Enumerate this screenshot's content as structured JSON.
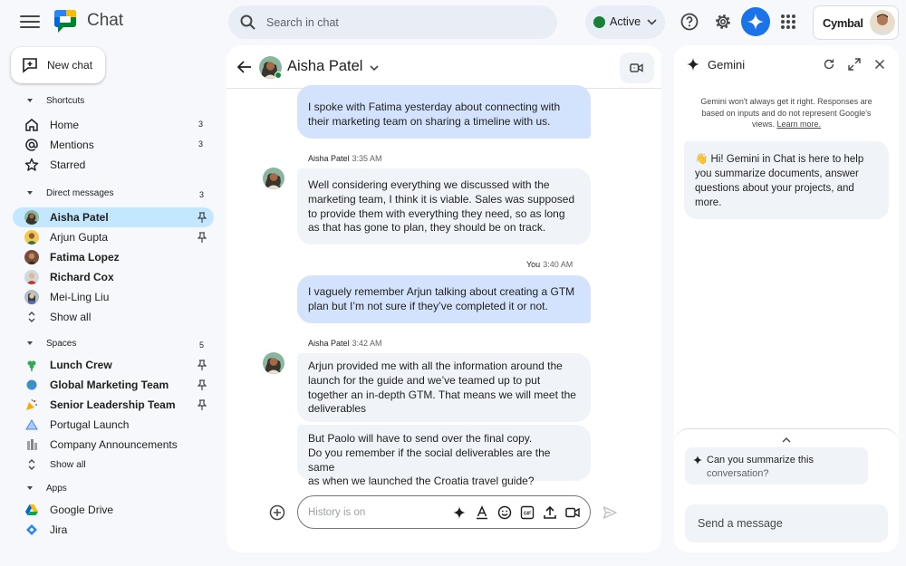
{
  "app": {
    "name": "Chat",
    "brand": "Cymbal"
  },
  "search": {
    "placeholder": "Search in chat"
  },
  "status": {
    "label": "Active",
    "color": "#188038"
  },
  "accent": "#1a73e8",
  "sidebar": {
    "new_chat": "New chat",
    "shortcuts": {
      "title": "Shortcuts",
      "items": [
        {
          "label": "Home",
          "count": "3"
        },
        {
          "label": "Mentions",
          "count": "3"
        },
        {
          "label": "Starred"
        }
      ]
    },
    "direct_messages": {
      "title": "Direct messages",
      "count": "3",
      "items": [
        {
          "label": "Aisha Patel"
        },
        {
          "label": "Arjun Gupta"
        },
        {
          "label": "Fatima Lopez"
        },
        {
          "label": "Richard Cox"
        },
        {
          "label": "Mei-Ling Liu"
        },
        {
          "label": "Show all"
        }
      ]
    },
    "spaces": {
      "title": "Spaces",
      "count": "5",
      "items": [
        {
          "label": "Lunch Crew"
        },
        {
          "label": "Global Marketing Team"
        },
        {
          "label": "Senior Leadership Team"
        },
        {
          "label": "Portugal Launch"
        },
        {
          "label": "Company Announcements"
        },
        {
          "label": "Show all"
        }
      ]
    },
    "apps": {
      "title": "Apps",
      "items": [
        {
          "label": "Google Drive"
        },
        {
          "label": "Jira"
        }
      ]
    }
  },
  "chat": {
    "title": "Aisha Patel",
    "messages": [
      {
        "lines": [
          "I spoke with Fatima yesterday about connecting with",
          "their marketing team on sharing a timeline with us."
        ]
      },
      {
        "sender": "Aisha Patel",
        "time": "3:35 AM",
        "lines": [
          "Well considering everything we discussed with the",
          "marketing team, I think it is viable. Sales was supposed",
          "to provide them with everything they need, so as long",
          "as that has gone to plan, they should be on track."
        ]
      },
      {
        "sender": "You",
        "time": "3:40 AM",
        "lines": [
          "I vaguely remember Arjun talking about creating a GTM",
          "plan but I’m not sure if they’ve completed it or not."
        ]
      },
      {
        "sender": "Aisha Patel",
        "time": "3:42 AM",
        "lines": [
          "Arjun provided me with all the information around the",
          "launch for the guide and we’ve teamed up to put",
          "together an in-depth GTM. That means we will meet the",
          "deliverables"
        ]
      },
      {
        "lines": [
          "But Paolo will have to send over the final copy.",
          "Do you remember if the social deliverables are the same",
          "as when we launched the Croatia travel guide?"
        ]
      }
    ],
    "composer_placeholder": "History is on"
  },
  "gemini": {
    "title": "Gemini",
    "disclaimer": "Gemini won't always get it right. Responses are based on inputs and do not represent Google's views.",
    "learn_more": "Learn more.",
    "greeting": "👋 Hi! Gemini in Chat is here to help you summarize documents, answer questions about your projects, and more.",
    "suggestion_line1": "Can you summarize this",
    "suggestion_line2": "conversation?",
    "input_placeholder": "Send a message"
  }
}
